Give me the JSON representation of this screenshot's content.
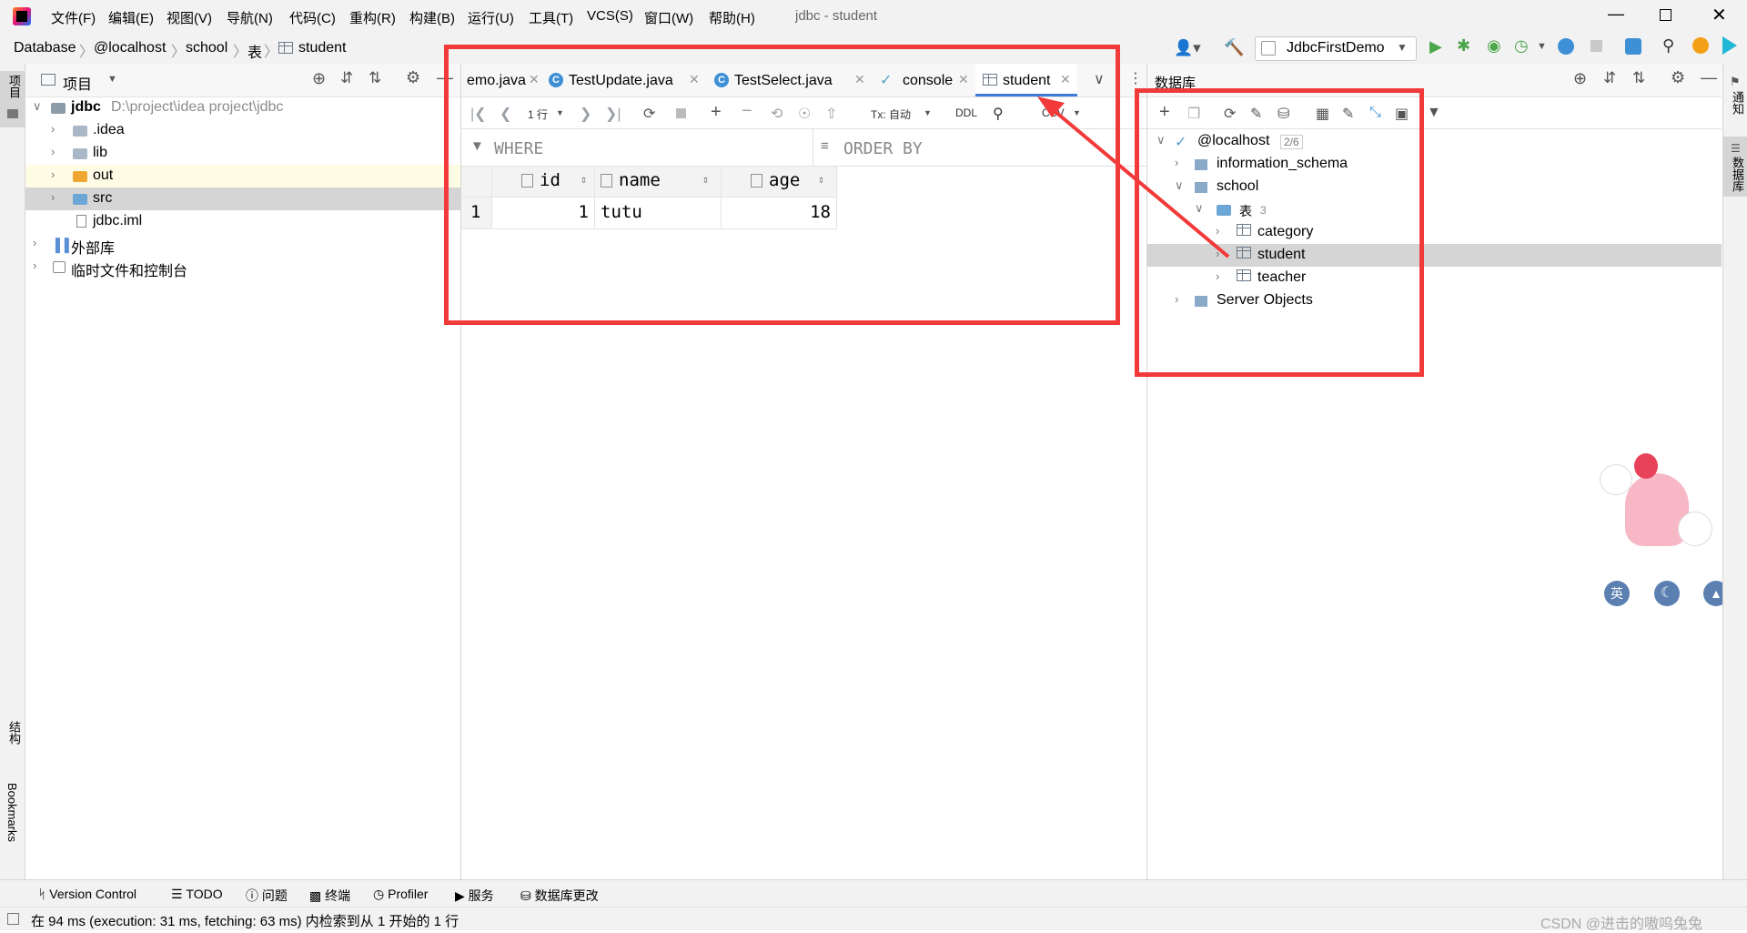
{
  "window": {
    "title": "jdbc - student"
  },
  "menu": [
    "文件(F)",
    "编辑(E)",
    "视图(V)",
    "导航(N)",
    "代码(C)",
    "重构(R)",
    "构建(B)",
    "运行(U)",
    "工具(T)",
    "VCS(S)",
    "窗口(W)",
    "帮助(H)"
  ],
  "breadcrumb": [
    "Database",
    "@localhost",
    "school",
    "表",
    "student"
  ],
  "run_config": "JdbcFirstDemo",
  "left_strip": {
    "project": "项目",
    "structure": "结构",
    "bookmarks": "Bookmarks"
  },
  "right_strip": {
    "notifications": "通知",
    "database": "数据库"
  },
  "project_panel": {
    "title": "项目",
    "tree": [
      {
        "label": "jdbc",
        "path": "D:\\project\\idea project\\jdbc"
      },
      {
        "label": ".idea"
      },
      {
        "label": "lib"
      },
      {
        "label": "out"
      },
      {
        "label": "src"
      },
      {
        "label": "jdbc.iml"
      },
      {
        "label": "外部库"
      },
      {
        "label": "临时文件和控制台"
      }
    ]
  },
  "editor": {
    "tabs": [
      {
        "label": "emo.java"
      },
      {
        "label": "TestUpdate.java"
      },
      {
        "label": "TestSelect.java"
      },
      {
        "label": "console"
      },
      {
        "label": "student",
        "active": true
      }
    ],
    "toolbar": {
      "rows": "1 行",
      "tx": "Tx: 自动",
      "ddl": "DDL",
      "export": "CSV"
    },
    "filter": {
      "where": "WHERE",
      "order_by": "ORDER BY"
    },
    "grid": {
      "columns": [
        "id",
        "name",
        "age"
      ],
      "rows": [
        {
          "num": "1",
          "id": "1",
          "name": "tutu",
          "age": "18"
        }
      ]
    }
  },
  "database_panel": {
    "title": "数据库",
    "tree": {
      "host": "@localhost",
      "host_count": "2/6",
      "schema1": "information_schema",
      "schema2": "school",
      "tables_folder": "表",
      "tables_count": "3",
      "tables": [
        "category",
        "student",
        "teacher"
      ],
      "server_objects": "Server Objects"
    }
  },
  "bottom_tabs": [
    "Version Control",
    "TODO",
    "问题",
    "终端",
    "Profiler",
    "服务",
    "数据库更改"
  ],
  "status": "在 94 ms (execution: 31 ms, fetching: 63 ms) 内检索到从 1 开始的 1 行",
  "watermark": "CSDN @进击的嗷呜兔兔",
  "widget_labels": [
    "英"
  ],
  "colors": {
    "highlight": "#f23a3a",
    "accent": "#3d7bd6",
    "selection": "#d5d5d5",
    "folder": "#a9b7c6",
    "out_folder": "#f0a732",
    "src_folder": "#6ba6d6"
  }
}
